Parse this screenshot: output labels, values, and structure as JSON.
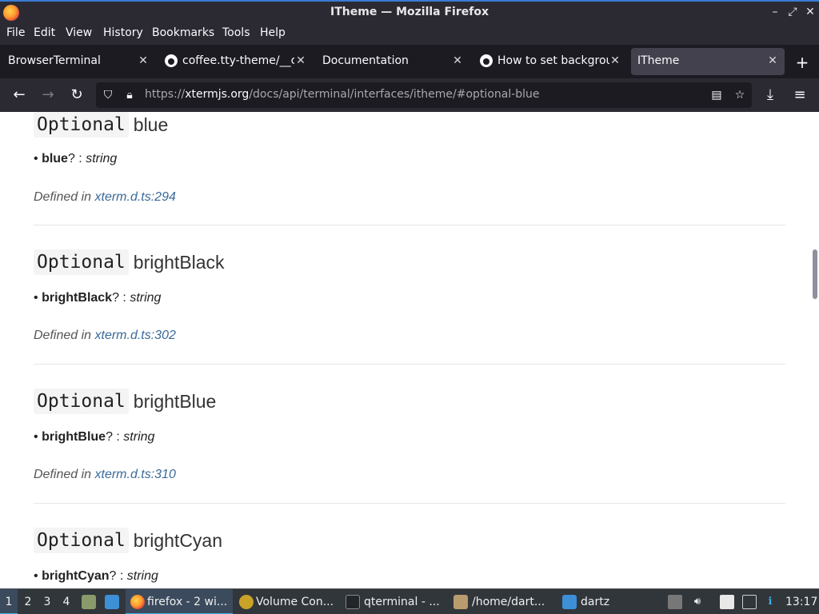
{
  "window": {
    "title": "ITheme — Mozilla Firefox"
  },
  "menu": [
    "File",
    "Edit",
    "View",
    "History",
    "Bookmarks",
    "Tools",
    "Help"
  ],
  "tabs": [
    {
      "label": "BrowserTerminal",
      "active": false
    },
    {
      "label": "coffee.tty-theme/__c",
      "active": false
    },
    {
      "label": "Documentation",
      "active": false
    },
    {
      "label": "How to set backgrou",
      "active": false
    },
    {
      "label": "ITheme",
      "active": true
    }
  ],
  "newtab": "+",
  "nav": {
    "url_prefix": "https://",
    "url_host": "xtermjs.org",
    "url_path": "/docs/api/terminal/interfaces/itheme/#optional-blue"
  },
  "content": {
    "sections": [
      {
        "keyword": "Optional",
        "name": "blue",
        "sig_name": "blue",
        "sig_rest": "? : ",
        "sig_type": "string",
        "defined_label": "Defined in ",
        "defined_link": "xterm.d.ts:294"
      },
      {
        "keyword": "Optional",
        "name": "brightBlack",
        "sig_name": "brightBlack",
        "sig_rest": "? : ",
        "sig_type": "string",
        "defined_label": "Defined in ",
        "defined_link": "xterm.d.ts:302"
      },
      {
        "keyword": "Optional",
        "name": "brightBlue",
        "sig_name": "brightBlue",
        "sig_rest": "? : ",
        "sig_type": "string",
        "defined_label": "Defined in ",
        "defined_link": "xterm.d.ts:310"
      },
      {
        "keyword": "Optional",
        "name": "brightCyan",
        "sig_name": "brightCyan",
        "sig_rest": "? : ",
        "sig_type": "string"
      }
    ],
    "bullet": "•"
  },
  "taskbar": {
    "workspaces": [
      "1",
      "2",
      "3",
      "4"
    ],
    "active_workspace": "1",
    "items": [
      {
        "label": "firefox - 2 wi...",
        "active": true
      },
      {
        "label": "Volume Con...",
        "active": false
      },
      {
        "label": "qterminal - ...",
        "active": false
      },
      {
        "label": "/home/dart...",
        "active": false
      },
      {
        "label": "dartz",
        "active": false
      }
    ],
    "clock": "13:17"
  },
  "colors": {
    "accent": "#3daee9",
    "link": "#3b6a99",
    "chrome_bg": "#2b2a33",
    "tabstrip_bg": "#1c1b22"
  }
}
